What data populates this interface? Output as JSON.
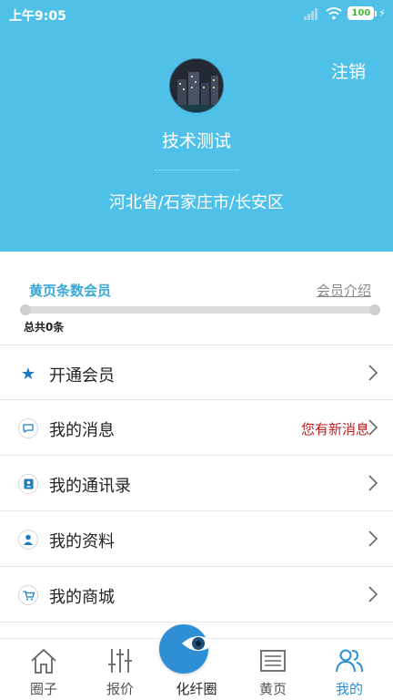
{
  "status_bar": {
    "time": "上午9:05",
    "battery": "100"
  },
  "header": {
    "logout_label": "注销",
    "user_name": "技术测试",
    "location": "河北省/石家庄市/长安区"
  },
  "member": {
    "title": "黄页条数会员",
    "intro_link": "会员介绍",
    "progress": 0,
    "total_text": "总共0条"
  },
  "menu": {
    "items": [
      {
        "label": "开通会员",
        "icon": "star-icon",
        "note": ""
      },
      {
        "label": "我的消息",
        "icon": "message-icon",
        "note": "您有新消息"
      },
      {
        "label": "我的通讯录",
        "icon": "contacts-icon",
        "note": ""
      },
      {
        "label": "我的资料",
        "icon": "person-icon",
        "note": ""
      },
      {
        "label": "我的商城",
        "icon": "cart-icon",
        "note": ""
      }
    ]
  },
  "tabbar": {
    "tabs": [
      {
        "label": "圈子",
        "icon": "home-icon",
        "active": false
      },
      {
        "label": "报价",
        "icon": "sliders-icon",
        "active": false
      },
      {
        "label": "化纤圈",
        "icon": "eye-icon",
        "active": false
      },
      {
        "label": "黄页",
        "icon": "list-icon",
        "active": false
      },
      {
        "label": "我的",
        "icon": "users-icon",
        "active": true
      }
    ]
  },
  "colors": {
    "header_bg": "#4fc1e8",
    "accent": "#2b8fd8",
    "alert": "#c01f1f",
    "member_title": "#3ba8d6"
  }
}
